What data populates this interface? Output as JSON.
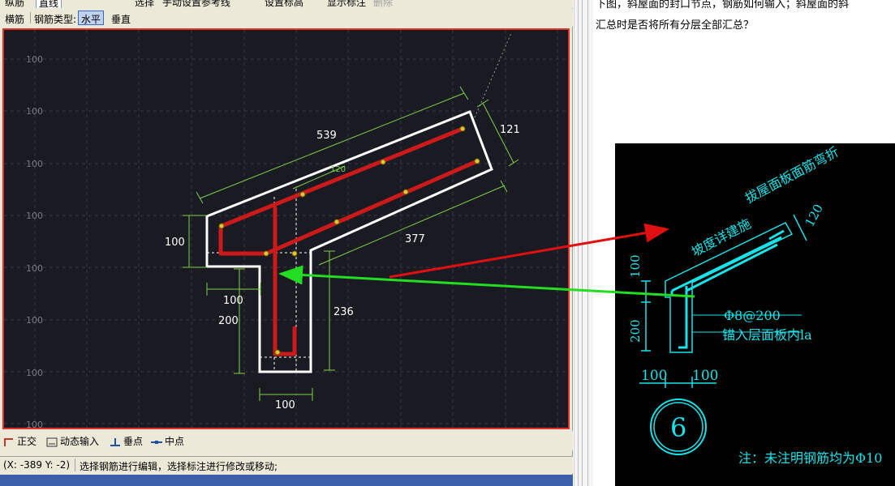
{
  "toolbar_top": {
    "items": [
      "纵筋",
      "直线",
      "选择",
      "手动设置参考线",
      "设置标高",
      "显示标注",
      "删除"
    ]
  },
  "toolbar_second": {
    "heng_jin": "横筋",
    "rebar_type_label": "钢筋类型:",
    "horizontal": "水平",
    "vertical": "垂直"
  },
  "drawing": {
    "grid_labels": [
      "100",
      "100",
      "100",
      "100",
      "100",
      "100",
      "100",
      "100"
    ],
    "dimensions": {
      "d539": "539",
      "d121": "121",
      "d100_left": "100",
      "d377": "377",
      "d100_bottom_left": "100",
      "d200": "200",
      "d236": "236",
      "d100_bottom": "100",
      "d_small": "120"
    },
    "colors": {
      "background": "#1a1a22",
      "outline": "#ffffff",
      "rebar": "#cc1a1a",
      "dimension": "#7fd04a",
      "grid": "#3a3a44",
      "border": "#e0302a"
    }
  },
  "snap_bar": {
    "orthogonal": "正交",
    "dynamic_input": "动态输入",
    "perpendicular": "垂点",
    "midpoint": "中点"
  },
  "status_bar": {
    "coords": "(X: -389 Y: -2)",
    "hint": "选择钢筋进行编辑，选择标注进行修改或移动;"
  },
  "post": {
    "line1": "下图，斜屋面的封口节点，钢筋如何输入；斜屋面的斜",
    "line2": "汇总时是否将所有分层全部汇总？"
  },
  "detail_drawing": {
    "text_slope_cast": "坡度详建施",
    "text_pull_through": "拔屋面板面筋弯折",
    "dim_top": "120",
    "dim_100": "100",
    "dim_200": "200",
    "rebar_spec": "Φ8@200",
    "anchor": "锚入层面板内la",
    "dim_100a": "100",
    "dim_100b": "100",
    "circle_label": "6",
    "note": "注：未注明钢筋均为Φ10",
    "colors": {
      "background": "#000000",
      "line": "#19e3ea",
      "arrow_red": "#e01010",
      "arrow_green": "#22dd22"
    }
  }
}
